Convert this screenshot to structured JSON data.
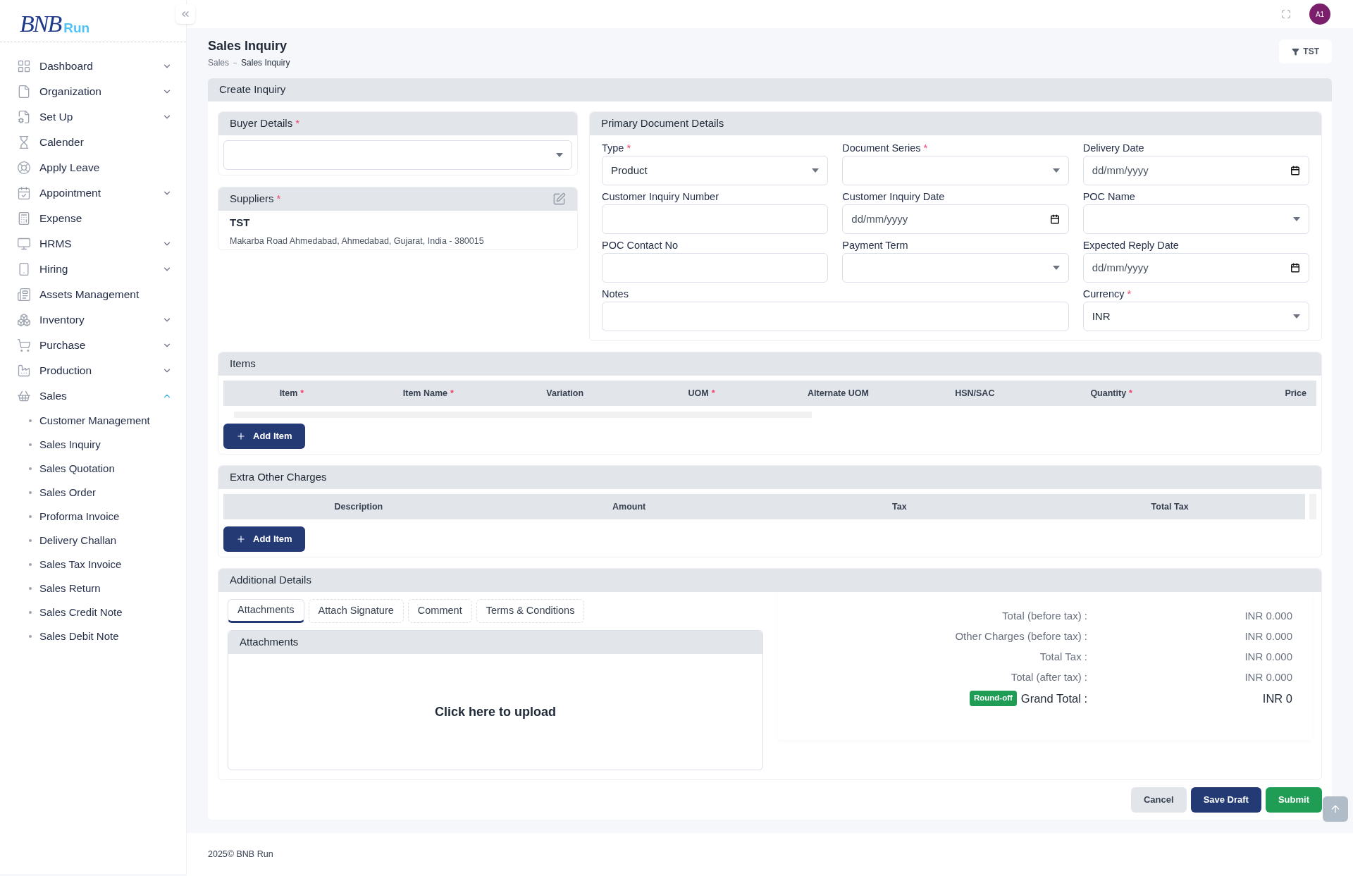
{
  "logo": {
    "mark": "BNB",
    "name": "Run"
  },
  "topbar": {
    "avatar": "A1"
  },
  "sidebar": {
    "items": [
      {
        "label": "Dashboard",
        "kind": "group",
        "expanded": false
      },
      {
        "label": "Organization",
        "kind": "group",
        "expanded": false
      },
      {
        "label": "Set Up",
        "kind": "group",
        "expanded": false
      },
      {
        "label": "Calender",
        "kind": "link"
      },
      {
        "label": "Apply Leave",
        "kind": "link"
      },
      {
        "label": "Appointment",
        "kind": "group",
        "expanded": false
      },
      {
        "label": "Expense",
        "kind": "link"
      },
      {
        "label": "HRMS",
        "kind": "group",
        "expanded": false
      },
      {
        "label": "Hiring",
        "kind": "group",
        "expanded": false
      },
      {
        "label": "Assets Management",
        "kind": "link"
      },
      {
        "label": "Inventory",
        "kind": "group",
        "expanded": false
      },
      {
        "label": "Purchase",
        "kind": "group",
        "expanded": false
      },
      {
        "label": "Production",
        "kind": "group",
        "expanded": false
      },
      {
        "label": "Sales",
        "kind": "group",
        "expanded": true,
        "children": [
          "Customer Management",
          "Sales Inquiry",
          "Sales Quotation",
          "Sales Order",
          "Proforma Invoice",
          "Delivery Challan",
          "Sales Tax Invoice",
          "Sales Return",
          "Sales Credit Note",
          "Sales Debit Note"
        ]
      }
    ]
  },
  "page": {
    "title": "Sales Inquiry",
    "breadcrumb": [
      "Sales",
      "Sales Inquiry"
    ],
    "filter_button": "TST"
  },
  "card_title": "Create Inquiry",
  "buyer": {
    "title": "Buyer Details",
    "required_mark": "*"
  },
  "suppliers": {
    "title": "Suppliers",
    "required_mark": "*",
    "name": "TST",
    "address": "Makarba Road Ahmedabad, Ahmedabad, Gujarat, India - 380015"
  },
  "primary": {
    "title": "Primary Document Details",
    "fields": [
      {
        "label": "Type",
        "required_mark": "*",
        "kind": "select",
        "value": "Product"
      },
      {
        "label": "Document Series",
        "required_mark": "*",
        "kind": "select"
      },
      {
        "label": "Delivery Date",
        "kind": "date",
        "placeholder": "dd/mm/yyyy"
      },
      {
        "label": "Customer Inquiry Number",
        "kind": "text"
      },
      {
        "label": "Customer Inquiry Date",
        "kind": "date",
        "placeholder": "dd/mm/yyyy"
      },
      {
        "label": "POC Name",
        "kind": "select"
      },
      {
        "label": "POC Contact No",
        "kind": "text"
      },
      {
        "label": "Payment Term",
        "kind": "select"
      },
      {
        "label": "Expected Reply Date",
        "kind": "date",
        "placeholder": "dd/mm/yyyy"
      },
      {
        "label": "Notes",
        "kind": "wide"
      },
      {
        "label": "Currency",
        "required_mark": "*",
        "kind": "select",
        "value": "INR"
      }
    ]
  },
  "items": {
    "title": "Items",
    "columns": [
      {
        "label": "Item",
        "required_mark": "*"
      },
      {
        "label": "Item Name",
        "required_mark": "*"
      },
      {
        "label": "Variation"
      },
      {
        "label": "UOM",
        "required_mark": "*"
      },
      {
        "label": "Alternate UOM"
      },
      {
        "label": "HSN/SAC"
      },
      {
        "label": "Quantity",
        "required_mark": "*"
      },
      {
        "label": "Price"
      }
    ],
    "add_button": "Add Item"
  },
  "charges": {
    "title": "Extra Other Charges",
    "columns": [
      "Description",
      "Amount",
      "Tax",
      "Total Tax"
    ],
    "add_button": "Add Item"
  },
  "additional": {
    "title": "Additional Details",
    "tabs": [
      {
        "label": "Attachments",
        "selected": true
      },
      {
        "label": "Attach Signature",
        "selected": false
      },
      {
        "label": "Comment",
        "selected": false
      },
      {
        "label": "Terms & Conditions",
        "selected": false
      }
    ],
    "attachments": {
      "title": "Attachments",
      "upload": "Click here to upload"
    },
    "totals": [
      {
        "label": "Total (before tax) :",
        "value": "INR 0.000",
        "kind": "line"
      },
      {
        "label": "Other Charges (before tax) :",
        "value": "INR 0.000",
        "kind": "line"
      },
      {
        "label": "Total Tax :",
        "value": "INR 0.000",
        "kind": "line"
      },
      {
        "label": "Total (after tax) :",
        "value": "INR 0.000",
        "kind": "line"
      },
      {
        "label": "Grand Total :",
        "value": "INR 0",
        "kind": "grand",
        "badge": "Round-off"
      }
    ]
  },
  "actions": [
    {
      "label": "Cancel",
      "kind": "cancel"
    },
    {
      "label": "Save Draft",
      "kind": "draft"
    },
    {
      "label": "Submit",
      "kind": "submit"
    }
  ],
  "footer": "2025© BNB Run"
}
